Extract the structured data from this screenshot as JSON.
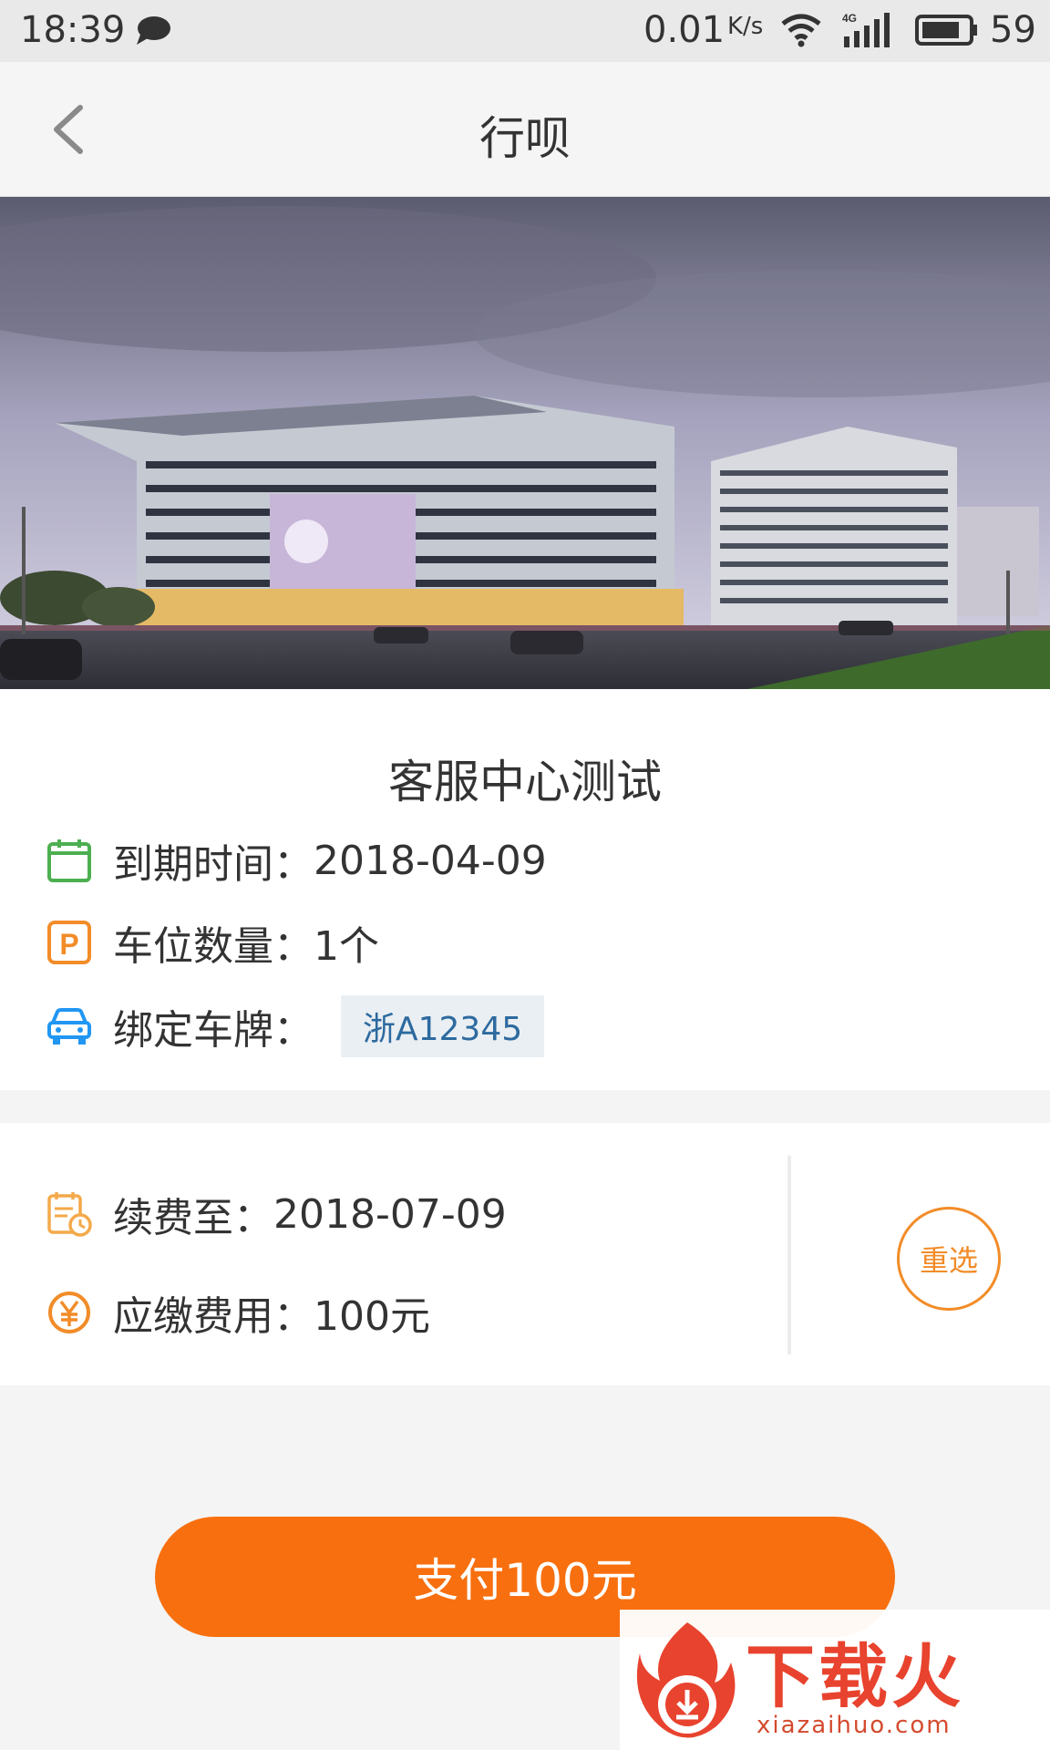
{
  "status_bar": {
    "time": "18:39",
    "net_speed": "0.01",
    "net_unit": "K/s",
    "network": "4G",
    "battery": "59",
    "icons": [
      "chat-icon",
      "wifi-icon",
      "signal-icon",
      "battery-icon"
    ]
  },
  "nav": {
    "title": "行呗",
    "back_icon": "chevron-left-icon"
  },
  "lot": {
    "name": "客服中心测试",
    "expiry_label": "到期时间：",
    "expiry_value": "2018-04-09",
    "spaces_label": "车位数量：",
    "spaces_value": "1个",
    "plate_label": "绑定车牌：",
    "plate_value": "浙A12345"
  },
  "renew": {
    "until_label": "续费至：",
    "until_value": "2018-07-09",
    "fee_label": "应缴费用：",
    "fee_value": "100元",
    "reselect_label": "重选"
  },
  "pay_button": {
    "label": "支付100元"
  },
  "watermark": {
    "title": "下载火",
    "url": "xiazaihuo.com"
  },
  "colors": {
    "accent": "#f86f0f",
    "accent_outline": "#f28c28",
    "calendar_icon": "#4caf50",
    "parking_icon": "#f28c28",
    "car_icon": "#2196f3",
    "plate_text": "#2d6a9f"
  }
}
